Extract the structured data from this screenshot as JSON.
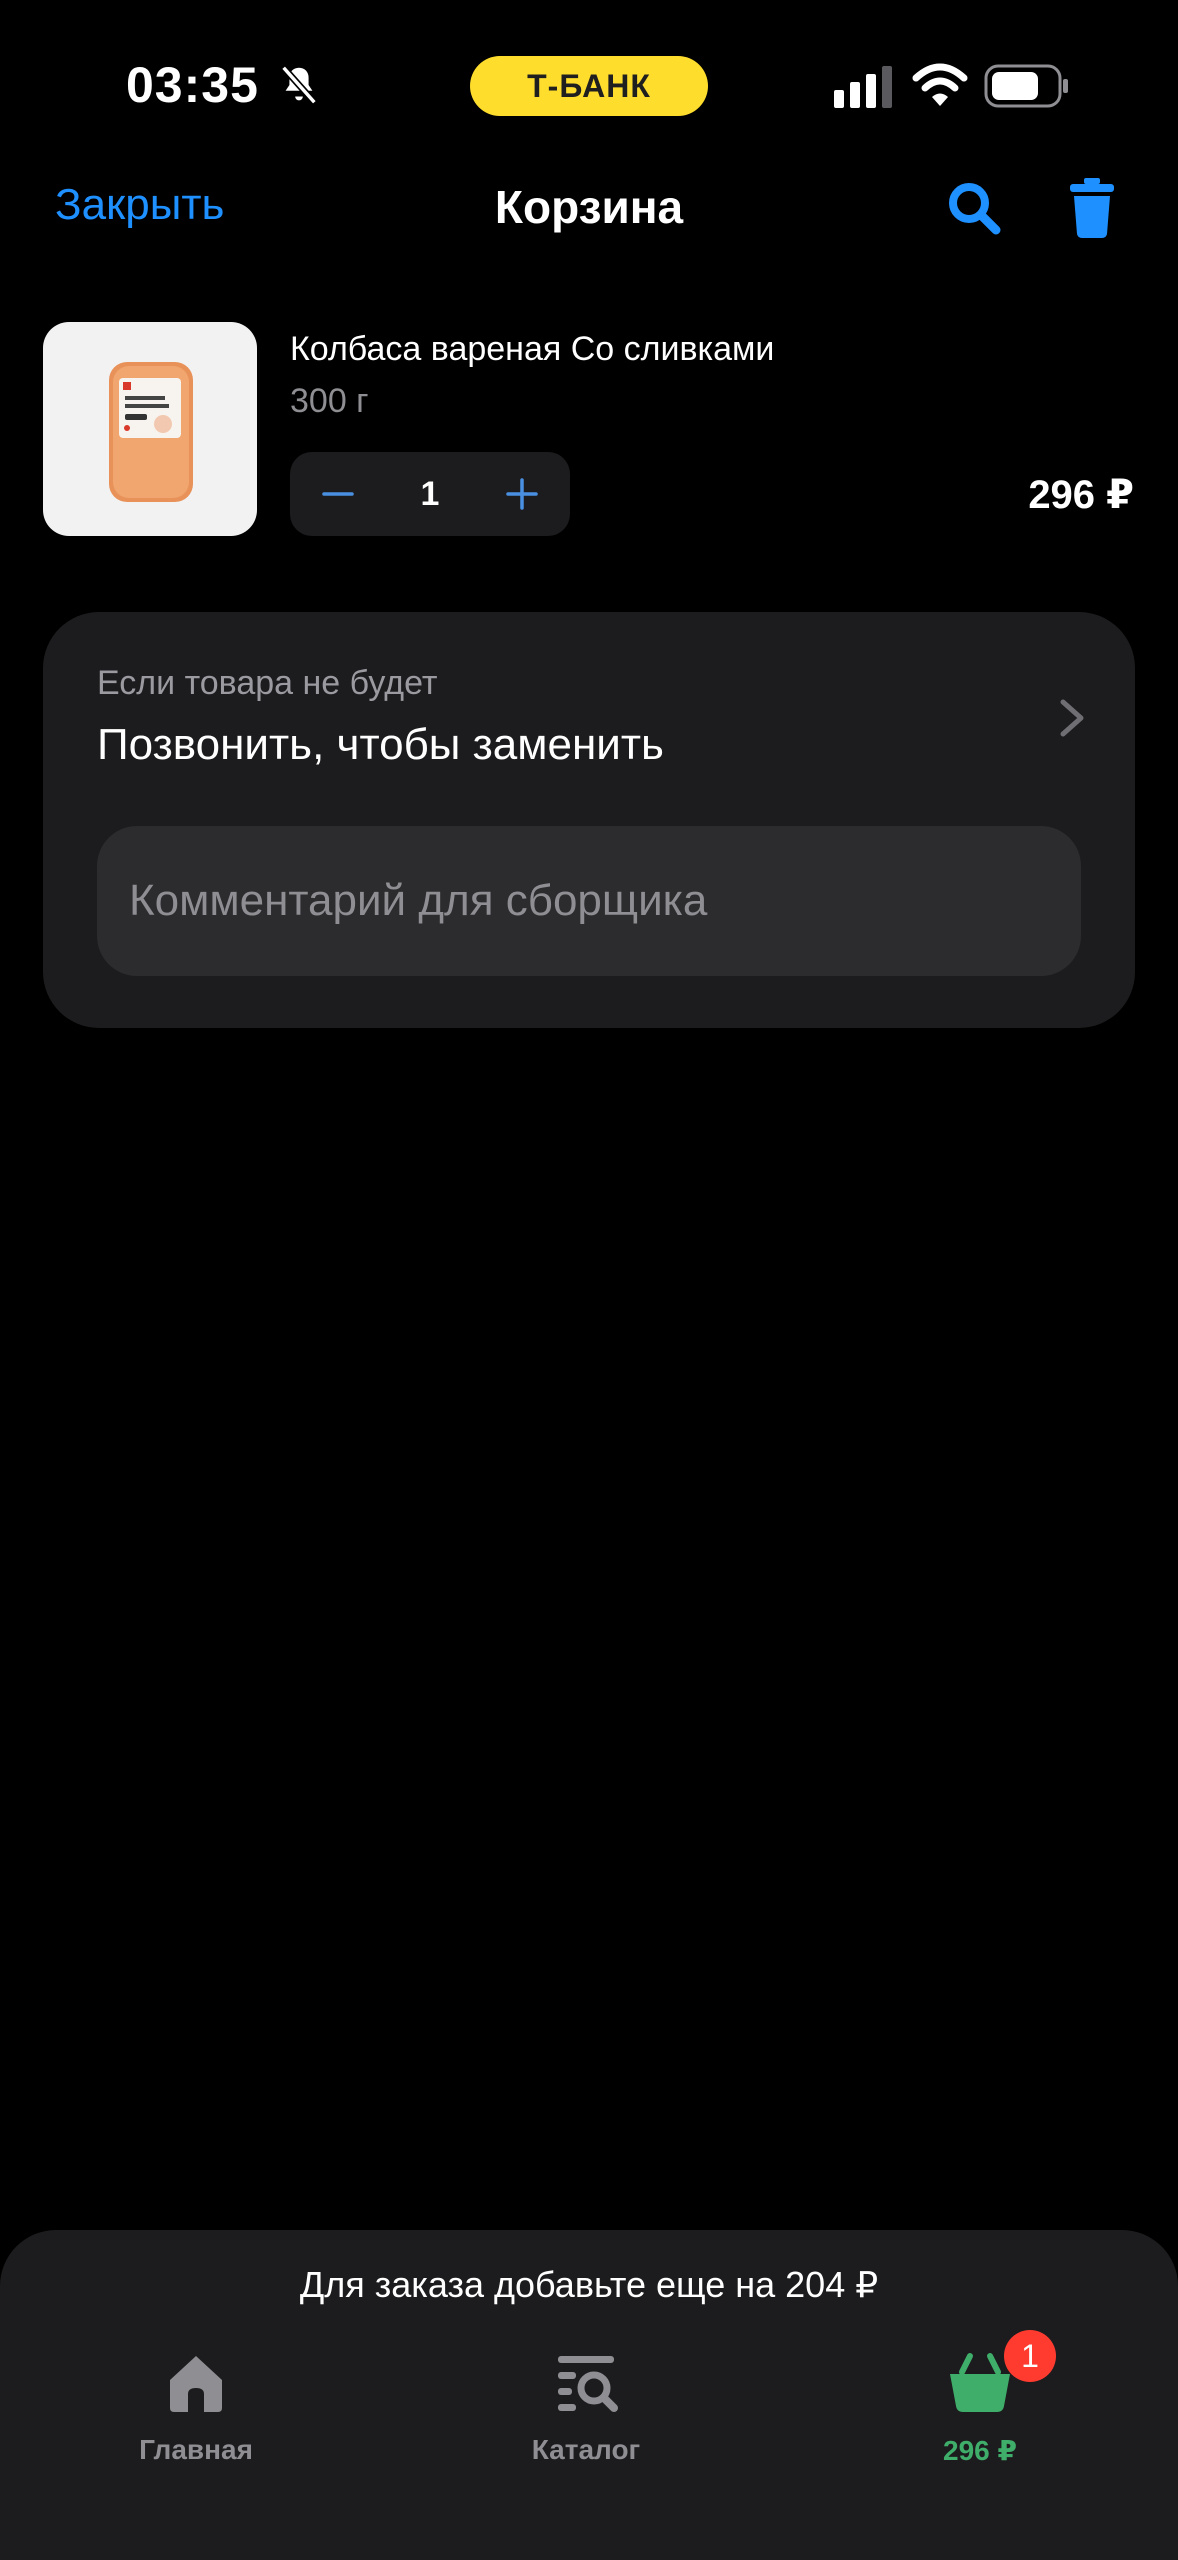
{
  "status_bar": {
    "time": "03:35",
    "bank_label": "Т-БАНК",
    "icons": [
      "bell-slash-icon",
      "signal-icon",
      "wifi-icon",
      "battery-icon"
    ]
  },
  "nav": {
    "close_label": "Закрыть",
    "title": "Корзина",
    "actions": [
      "search-icon",
      "trash-icon"
    ]
  },
  "cart": {
    "items": [
      {
        "name": "Колбаса вареная Со сливками",
        "weight": "300 г",
        "quantity": "1",
        "price": "296 ₽"
      }
    ]
  },
  "options": {
    "replace_caption": "Если товара не будет",
    "replace_value": "Позвонить, чтобы заменить",
    "comment_placeholder": "Комментарий для сборщика"
  },
  "bottom": {
    "min_order_note": "Для заказа добавьте еще на 204 ₽",
    "tabs": [
      {
        "label": "Главная",
        "icon": "home-icon"
      },
      {
        "label": "Каталог",
        "icon": "catalog-search-icon"
      },
      {
        "label": "296 ₽",
        "icon": "basket-icon",
        "badge": "1"
      }
    ]
  },
  "colors": {
    "accent_blue": "#1e90ff",
    "bank_yellow": "#ffdd2d",
    "cart_green": "#3fae6a",
    "badge_red": "#ff3b30",
    "card_bg": "#1c1c1e"
  }
}
